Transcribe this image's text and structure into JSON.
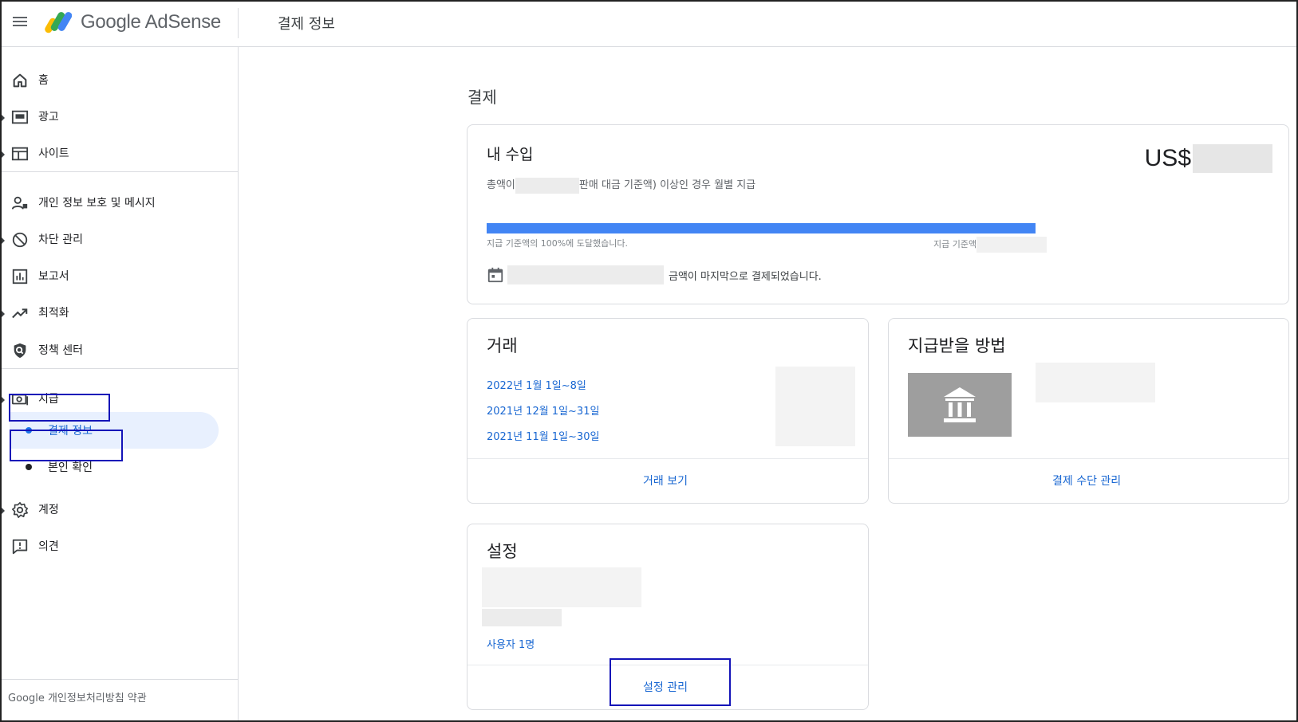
{
  "header": {
    "brand": "Google AdSense",
    "page_title": "결제 정보"
  },
  "sidebar": {
    "items": [
      {
        "label": "홈",
        "icon": "home-icon"
      },
      {
        "label": "광고",
        "icon": "ads-icon"
      },
      {
        "label": "사이트",
        "icon": "sites-icon"
      },
      {
        "label": "개인 정보 보호 및 메시지",
        "icon": "privacy-messaging-icon"
      },
      {
        "label": "차단 관리",
        "icon": "block-icon"
      },
      {
        "label": "보고서",
        "icon": "reports-icon"
      },
      {
        "label": "최적화",
        "icon": "optimization-icon"
      },
      {
        "label": "정책 센터",
        "icon": "policy-shield-icon"
      },
      {
        "label": "지급",
        "icon": "payments-icon"
      },
      {
        "label": "계정",
        "icon": "gear-icon"
      },
      {
        "label": "의견",
        "icon": "feedback-icon"
      }
    ],
    "subitems": [
      {
        "label": "결제 정보"
      },
      {
        "label": "본인 확인"
      }
    ],
    "footer": "Google 개인정보처리방침 약관"
  },
  "main": {
    "section_title": "결제",
    "earnings": {
      "title": "내 수입",
      "currency": "US$",
      "threshold_prefix": "총액이",
      "threshold_suffix": "판매 대금 기준액) 이상인 경우 월별 지급",
      "progress_fraction": 1.0,
      "progress_left_label": "지급 기준액의 100%에 도달했습니다.",
      "progress_right_label": "지급 기준액",
      "last_paid_text": "금액이 마지막으로 결제되었습니다."
    },
    "transactions": {
      "title": "거래",
      "periods": [
        "2022년 1월 1일~8일",
        "2021년 12월 1일~31일",
        "2021년 11월 1일~30일"
      ],
      "view_button": "거래 보기"
    },
    "payment_method": {
      "title": "지급받을 방법",
      "manage_button": "결제 수단 관리"
    },
    "settings": {
      "title": "설정",
      "users_link": "사용자 1명",
      "manage_button": "설정 관리"
    }
  }
}
